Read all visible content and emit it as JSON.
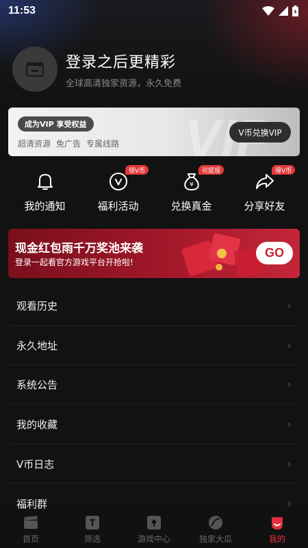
{
  "status": {
    "time": "11:53"
  },
  "profile": {
    "title": "登录之后更精彩",
    "subtitle": "全球高清独家资源，永久免费"
  },
  "vip": {
    "badge": "成为VIP 享受权益",
    "perks": [
      "超清资源",
      "免广告",
      "专属线路"
    ],
    "button": "V币兑换VIP",
    "watermark": "VIP"
  },
  "quick": [
    {
      "label": "我的通知",
      "icon": "bell-icon",
      "tag": ""
    },
    {
      "label": "福利活动",
      "icon": "v-coin-icon",
      "tag": "领V币"
    },
    {
      "label": "兑换真金",
      "icon": "money-bag-icon",
      "tag": "可提现"
    },
    {
      "label": "分享好友",
      "icon": "share-icon",
      "tag": "得V币"
    }
  ],
  "banner": {
    "title": "现金红包雨千万奖池来袭",
    "subtitle": "登录一起看官方游戏平台开抢啦!",
    "button": "GO"
  },
  "menu": [
    "观看历史",
    "永久地址",
    "系统公告",
    "我的收藏",
    "V币日志",
    "福利群"
  ],
  "tabs": [
    {
      "label": "首页",
      "icon": "clapperboard-icon"
    },
    {
      "label": "筛选",
      "icon": "filter-icon"
    },
    {
      "label": "游戏中心",
      "icon": "game-icon"
    },
    {
      "label": "独家大瓜",
      "icon": "melon-icon"
    },
    {
      "label": "我的",
      "icon": "profile-icon",
      "active": true
    }
  ],
  "colors": {
    "accent": "#e0303c",
    "background": "#121212"
  }
}
